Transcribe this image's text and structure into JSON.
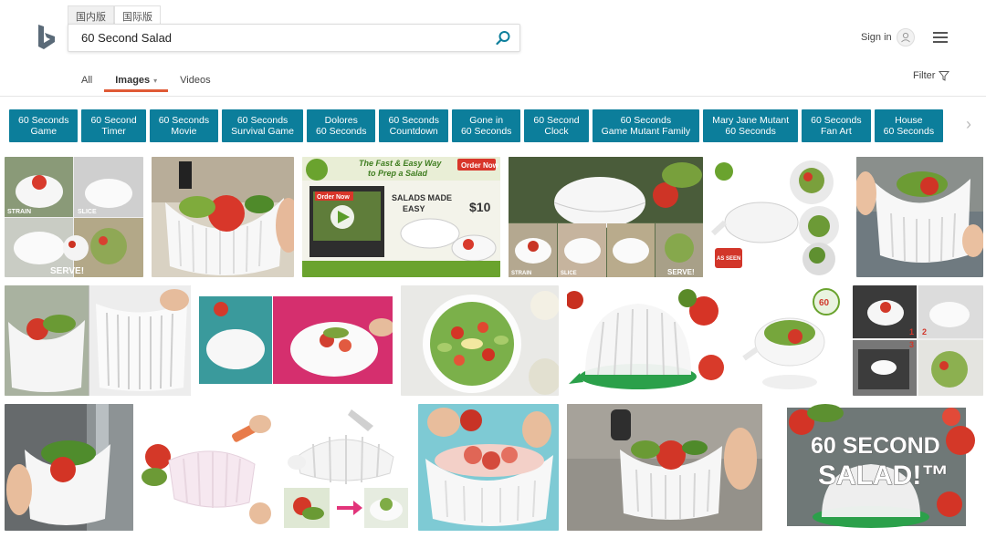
{
  "header": {
    "market_tabs": [
      "国内版",
      "国际版"
    ],
    "search_value": "60 Second Salad",
    "signin_label": "Sign in"
  },
  "scopes": [
    {
      "label": "All"
    },
    {
      "label": "Images",
      "caret": "▾"
    },
    {
      "label": "Videos"
    }
  ],
  "filter_label": "Filter",
  "chips": [
    [
      "60 Seconds",
      "Game"
    ],
    [
      "60 Second",
      "Timer"
    ],
    [
      "60 Seconds",
      "Movie"
    ],
    [
      "60 Seconds",
      "Survival Game"
    ],
    [
      "Dolores",
      "60 Seconds"
    ],
    [
      "60 Seconds",
      "Countdown"
    ],
    [
      "Gone in",
      "60 Seconds"
    ],
    [
      "60 Second",
      "Clock"
    ],
    [
      "60 Seconds",
      "Game Mutant Family"
    ],
    [
      "Mary Jane Mutant",
      "60 Seconds"
    ],
    [
      "60 Seconds",
      "Fan Art"
    ],
    [
      "House",
      "60 Seconds"
    ]
  ],
  "image_text": {
    "strain": "STRAIN",
    "slice": "SLICE",
    "serve": "SERVE!",
    "ad_headline_1": "The Fast & Easy Way",
    "ad_headline_2": "to Prep a Salad",
    "order_now": "Order Now",
    "salads_made_easy_1": "SALADS MADE",
    "salads_made_easy_2": "EASY",
    "price": "$10",
    "as_seen_on_tv": "AS SEEN ON TV",
    "big_title_1": "60 SECOND",
    "big_title_2": "SALAD!™",
    "steps": [
      "1",
      "2",
      "3"
    ]
  },
  "colors": {
    "chip_bg": "#0c7e9b",
    "active_scope_underline": "#e05a36",
    "bing_logo": "#258ffa"
  }
}
